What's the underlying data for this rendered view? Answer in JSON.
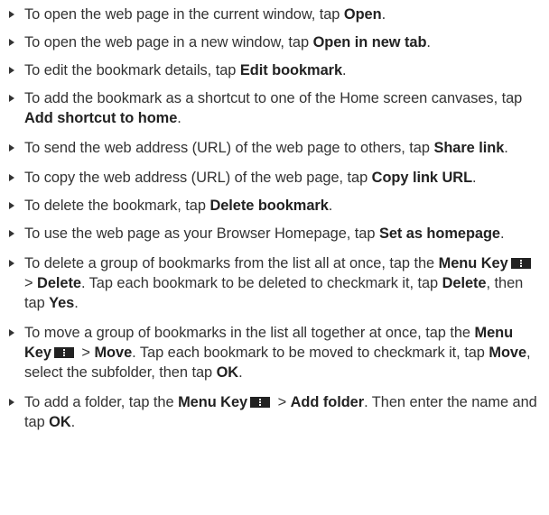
{
  "items": [
    {
      "t1": "To open the web page in the current window, tap ",
      "b1": "Open",
      "t2": "."
    },
    {
      "t1": "To open the web page in a new window, tap ",
      "b1": "Open in new tab",
      "t2": "."
    },
    {
      "t1": "To edit the bookmark details, tap ",
      "b1": "Edit bookmark",
      "t2": "."
    },
    {
      "t1": "To add the bookmark as a shortcut to one of the Home screen canvases, tap ",
      "b1": "Add shortcut to home",
      "t2": "."
    },
    {
      "t1": "To send the web address (URL) of the web page to others, tap ",
      "b1": "Share link",
      "t2": "."
    },
    {
      "t1": "To copy the web address (URL) of the web page, tap ",
      "b1": "Copy link URL",
      "t2": "."
    },
    {
      "t1": "To delete the bookmark, tap ",
      "b1": "Delete bookmark",
      "t2": "."
    },
    {
      "t1": "To use the web page as your Browser Homepage, tap ",
      "b1": "Set as homepage",
      "t2": "."
    },
    {
      "t1": "To delete a group of bookmarks from the list all at once, tap the ",
      "b1": "Menu Key",
      "t2": " > ",
      "b2": "Delete",
      "t3": ". Tap each bookmark to be deleted to checkmark it, tap ",
      "b3": "Delete",
      "t4": ", then tap ",
      "b4": "Yes",
      "t5": "."
    },
    {
      "t1": "To move a group of bookmarks in the list all together at once, tap the ",
      "b1": "Menu Key",
      "t2": " > ",
      "b2": "Move",
      "t3": ". Tap each bookmark to be moved to checkmark it, tap ",
      "b3": "Move",
      "t4": ", select the subfolder, then tap ",
      "b4": "OK",
      "t5": "."
    },
    {
      "t1": "To add a folder, tap the ",
      "b1": "Menu Key",
      "t2": " > ",
      "b2": "Add folder",
      "t3": ". Then enter the name and tap ",
      "b3": "OK",
      "t4": "."
    }
  ],
  "icons": {
    "bullet": "triangle-bullet-icon",
    "menu_key": "menu-key-icon"
  },
  "colors": {
    "text": "#333333",
    "emphasis": "#222222"
  }
}
